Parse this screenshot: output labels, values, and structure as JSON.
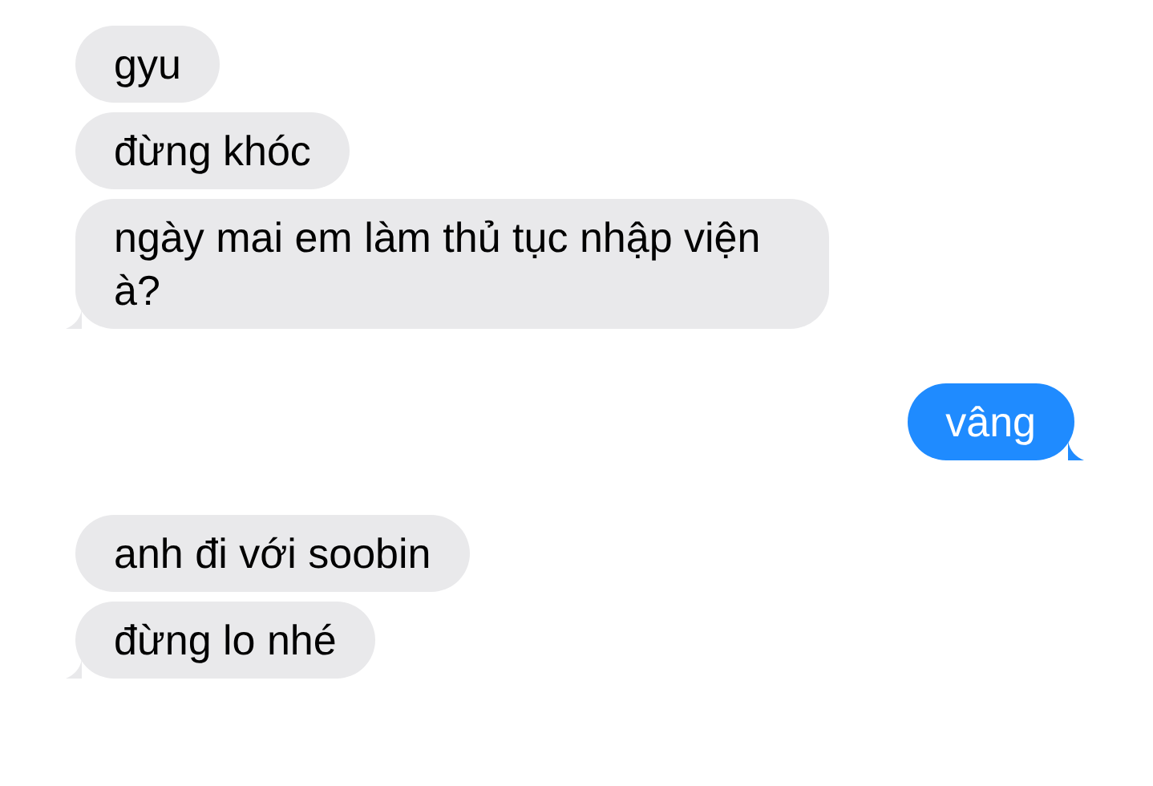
{
  "messages": [
    {
      "text": "gyu",
      "kind": "incoming",
      "tail": false
    },
    {
      "text": "đừng khóc",
      "kind": "incoming",
      "tail": false
    },
    {
      "text": "ngày mai em làm thủ tục nhập viện à?",
      "kind": "incoming",
      "tail": true
    },
    {
      "text": "vâng",
      "kind": "outgoing",
      "tail": true
    },
    {
      "text": "anh đi với soobin",
      "kind": "incoming",
      "tail": false
    },
    {
      "text": "đừng lo nhé",
      "kind": "incoming",
      "tail": true
    }
  ]
}
